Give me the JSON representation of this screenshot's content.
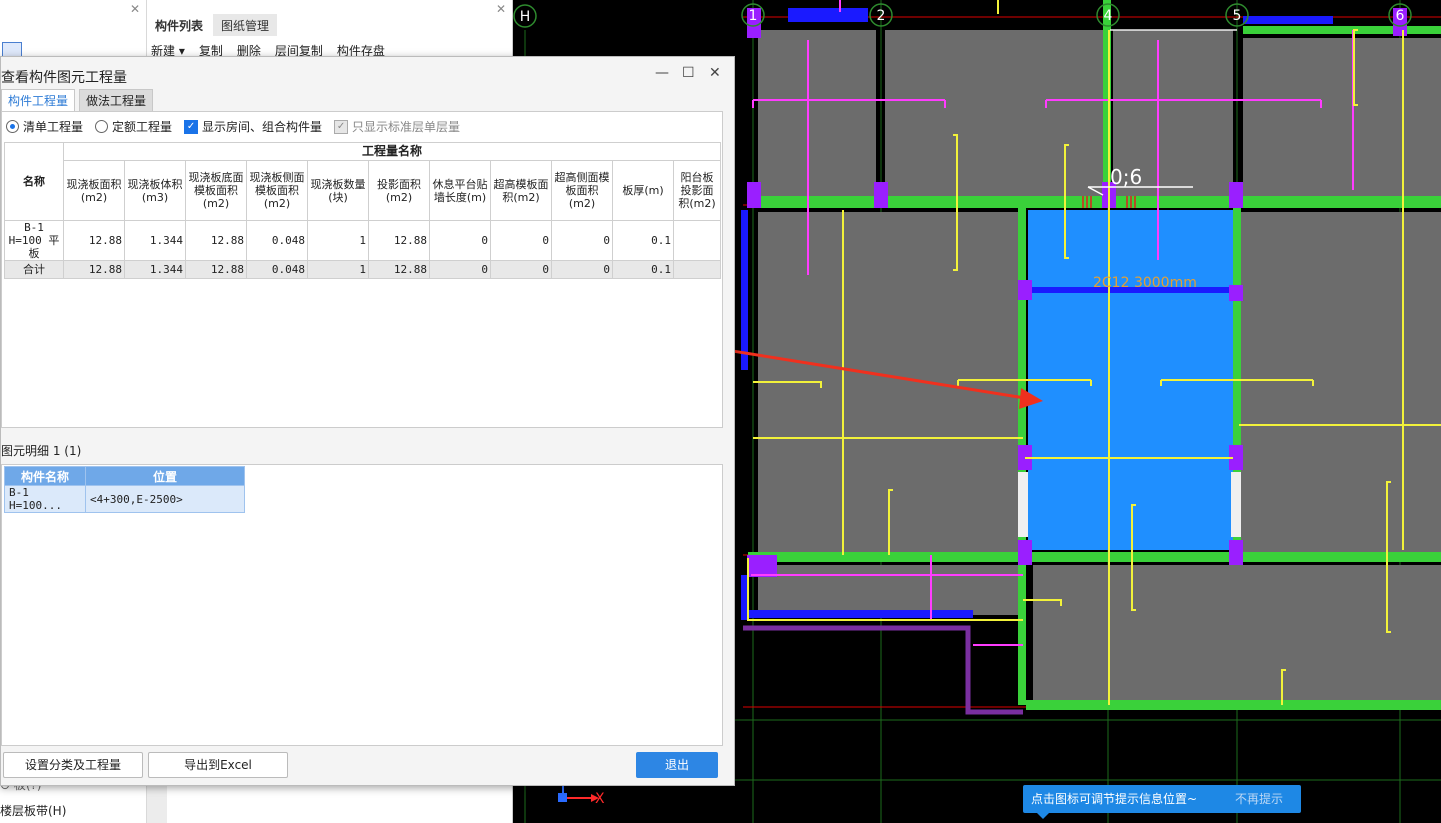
{
  "left_panel": {
    "bottom_prev": "⊙ 板(?)",
    "bottom_item": "楼层板带(H)"
  },
  "comp_panel": {
    "tabs": [
      "构件列表",
      "图纸管理"
    ],
    "toolbar": [
      "新建 ▾",
      "复制",
      "删除",
      "层间复制",
      "构件存盘"
    ]
  },
  "dialog": {
    "title": "查看构件图元工程量",
    "tabs": [
      "构件工程量",
      "做法工程量"
    ],
    "options": {
      "list_qty": "清单工程量",
      "quota_qty": "定额工程量",
      "show_rooms": "显示房间、组合构件量",
      "std_floor_only": "只显示标准层单层量"
    },
    "table": {
      "name_header": "名称",
      "group_header": "工程量名称",
      "columns": [
        "现浇板面积(m2)",
        "现浇板体积(m3)",
        "现浇板底面模板面积(m2)",
        "现浇板侧面模板面积(m2)",
        "现浇板数量(块)",
        "投影面积(m2)",
        "休息平台贴墙长度(m)",
        "超高模板面积(m2)",
        "超高侧面模板面积(m2)",
        "板厚(m)",
        "阳台板投影面积(m2)"
      ],
      "rows": [
        {
          "name": "B-1 H=100 平板",
          "values": [
            "12.88",
            "1.344",
            "12.88",
            "0.048",
            "1",
            "12.88",
            "0",
            "0",
            "0",
            "0.1",
            ""
          ]
        },
        {
          "name": "合计",
          "values": [
            "12.88",
            "1.344",
            "12.88",
            "0.048",
            "1",
            "12.88",
            "0",
            "0",
            "0",
            "0.1",
            ""
          ]
        }
      ]
    },
    "detail": {
      "label": "图元明细  1 (1)",
      "headers": [
        "构件名称",
        "位置"
      ],
      "rows": [
        {
          "name": "B-1 H=100...",
          "position": "<4+300,E-2500>"
        }
      ]
    },
    "buttons": {
      "settings": "设置分类及工程量",
      "export": "导出到Excel",
      "exit": "退出"
    }
  },
  "cad": {
    "axis_labels": [
      "H",
      "1",
      "2",
      "4",
      "5",
      "6"
    ],
    "rebar_count": "0;6",
    "rebar_text": "2C12 3000mm",
    "coord_x": "X"
  },
  "tip": {
    "message": "点击图标可调节提示信息位置~",
    "dismiss": "不再提示"
  }
}
